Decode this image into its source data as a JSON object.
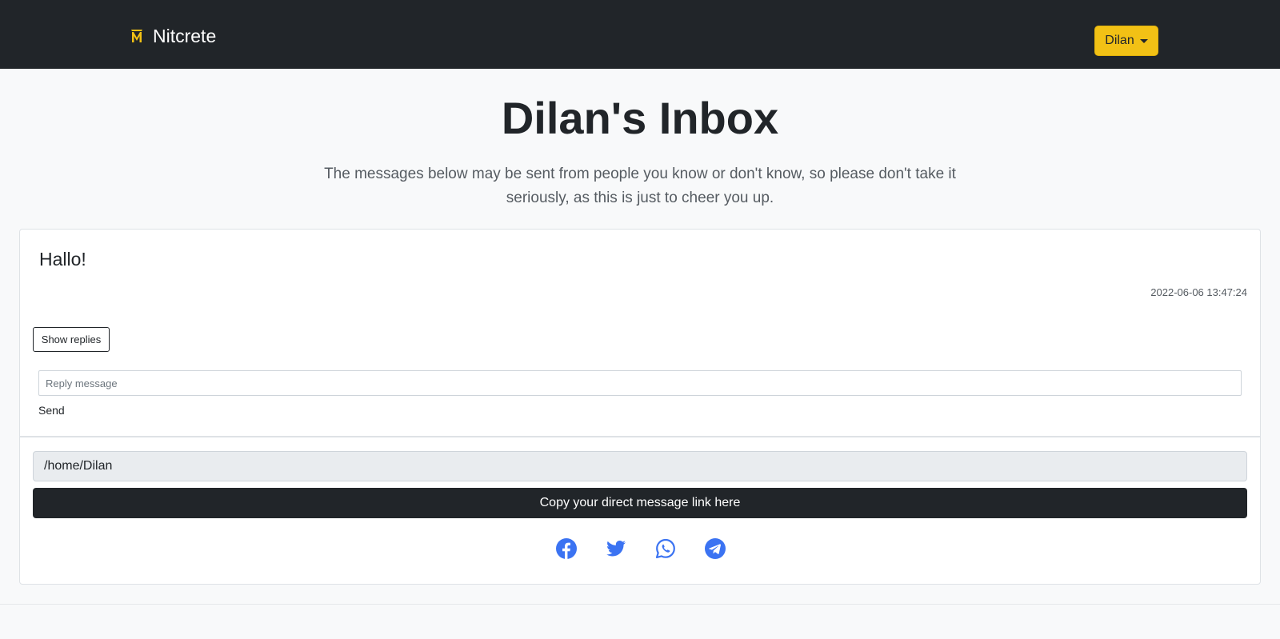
{
  "navbar": {
    "brand": "Nitcrete",
    "logo_icon": "mask-logo-icon",
    "user_menu_label": "Dilan",
    "colors": {
      "background": "#212529",
      "accent": "#f2c115"
    }
  },
  "header": {
    "title": "Dilan's Inbox",
    "subtitle": "The messages below may be sent from people you know or don't know, so please don't take it seriously, as this is just to cheer you up."
  },
  "message": {
    "text": "Hallo!",
    "timestamp": "2022-06-06 13:47:24",
    "show_replies_label": "Show replies",
    "reply_placeholder": "Reply message",
    "send_label": "Send"
  },
  "share": {
    "link_value": "/home/Dilan",
    "copy_label": "Copy your direct message link here",
    "icons": [
      "facebook-icon",
      "twitter-icon",
      "whatsapp-icon",
      "telegram-icon"
    ],
    "icon_color": "#3b73f2"
  }
}
